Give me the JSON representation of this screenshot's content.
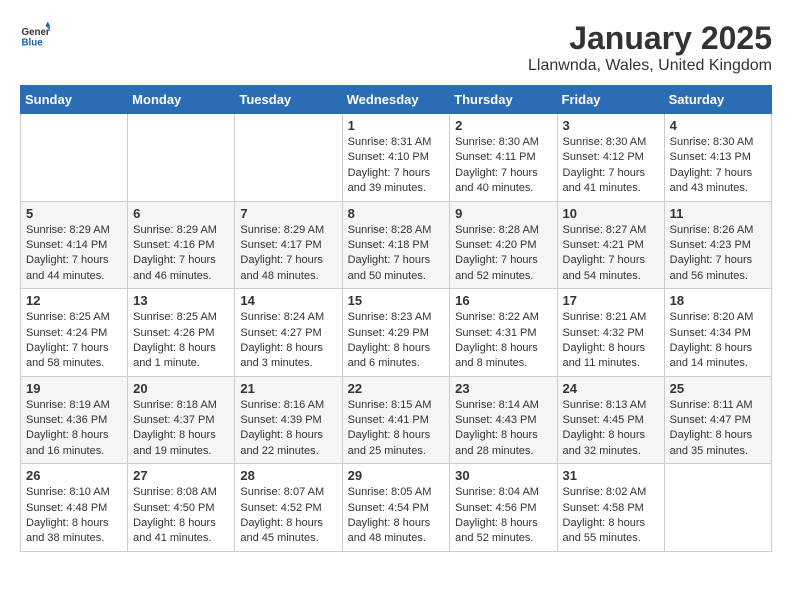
{
  "header": {
    "logo": {
      "general": "General",
      "blue": "Blue"
    },
    "title": "January 2025",
    "location": "Llanwnda, Wales, United Kingdom"
  },
  "weekdays": [
    "Sunday",
    "Monday",
    "Tuesday",
    "Wednesday",
    "Thursday",
    "Friday",
    "Saturday"
  ],
  "weeks": [
    [
      {
        "day": "",
        "content": ""
      },
      {
        "day": "",
        "content": ""
      },
      {
        "day": "",
        "content": ""
      },
      {
        "day": "1",
        "sunrise": "Sunrise: 8:31 AM",
        "sunset": "Sunset: 4:10 PM",
        "daylight": "Daylight: 7 hours and 39 minutes."
      },
      {
        "day": "2",
        "sunrise": "Sunrise: 8:30 AM",
        "sunset": "Sunset: 4:11 PM",
        "daylight": "Daylight: 7 hours and 40 minutes."
      },
      {
        "day": "3",
        "sunrise": "Sunrise: 8:30 AM",
        "sunset": "Sunset: 4:12 PM",
        "daylight": "Daylight: 7 hours and 41 minutes."
      },
      {
        "day": "4",
        "sunrise": "Sunrise: 8:30 AM",
        "sunset": "Sunset: 4:13 PM",
        "daylight": "Daylight: 7 hours and 43 minutes."
      }
    ],
    [
      {
        "day": "5",
        "sunrise": "Sunrise: 8:29 AM",
        "sunset": "Sunset: 4:14 PM",
        "daylight": "Daylight: 7 hours and 44 minutes."
      },
      {
        "day": "6",
        "sunrise": "Sunrise: 8:29 AM",
        "sunset": "Sunset: 4:16 PM",
        "daylight": "Daylight: 7 hours and 46 minutes."
      },
      {
        "day": "7",
        "sunrise": "Sunrise: 8:29 AM",
        "sunset": "Sunset: 4:17 PM",
        "daylight": "Daylight: 7 hours and 48 minutes."
      },
      {
        "day": "8",
        "sunrise": "Sunrise: 8:28 AM",
        "sunset": "Sunset: 4:18 PM",
        "daylight": "Daylight: 7 hours and 50 minutes."
      },
      {
        "day": "9",
        "sunrise": "Sunrise: 8:28 AM",
        "sunset": "Sunset: 4:20 PM",
        "daylight": "Daylight: 7 hours and 52 minutes."
      },
      {
        "day": "10",
        "sunrise": "Sunrise: 8:27 AM",
        "sunset": "Sunset: 4:21 PM",
        "daylight": "Daylight: 7 hours and 54 minutes."
      },
      {
        "day": "11",
        "sunrise": "Sunrise: 8:26 AM",
        "sunset": "Sunset: 4:23 PM",
        "daylight": "Daylight: 7 hours and 56 minutes."
      }
    ],
    [
      {
        "day": "12",
        "sunrise": "Sunrise: 8:25 AM",
        "sunset": "Sunset: 4:24 PM",
        "daylight": "Daylight: 7 hours and 58 minutes."
      },
      {
        "day": "13",
        "sunrise": "Sunrise: 8:25 AM",
        "sunset": "Sunset: 4:26 PM",
        "daylight": "Daylight: 8 hours and 1 minute."
      },
      {
        "day": "14",
        "sunrise": "Sunrise: 8:24 AM",
        "sunset": "Sunset: 4:27 PM",
        "daylight": "Daylight: 8 hours and 3 minutes."
      },
      {
        "day": "15",
        "sunrise": "Sunrise: 8:23 AM",
        "sunset": "Sunset: 4:29 PM",
        "daylight": "Daylight: 8 hours and 6 minutes."
      },
      {
        "day": "16",
        "sunrise": "Sunrise: 8:22 AM",
        "sunset": "Sunset: 4:31 PM",
        "daylight": "Daylight: 8 hours and 8 minutes."
      },
      {
        "day": "17",
        "sunrise": "Sunrise: 8:21 AM",
        "sunset": "Sunset: 4:32 PM",
        "daylight": "Daylight: 8 hours and 11 minutes."
      },
      {
        "day": "18",
        "sunrise": "Sunrise: 8:20 AM",
        "sunset": "Sunset: 4:34 PM",
        "daylight": "Daylight: 8 hours and 14 minutes."
      }
    ],
    [
      {
        "day": "19",
        "sunrise": "Sunrise: 8:19 AM",
        "sunset": "Sunset: 4:36 PM",
        "daylight": "Daylight: 8 hours and 16 minutes."
      },
      {
        "day": "20",
        "sunrise": "Sunrise: 8:18 AM",
        "sunset": "Sunset: 4:37 PM",
        "daylight": "Daylight: 8 hours and 19 minutes."
      },
      {
        "day": "21",
        "sunrise": "Sunrise: 8:16 AM",
        "sunset": "Sunset: 4:39 PM",
        "daylight": "Daylight: 8 hours and 22 minutes."
      },
      {
        "day": "22",
        "sunrise": "Sunrise: 8:15 AM",
        "sunset": "Sunset: 4:41 PM",
        "daylight": "Daylight: 8 hours and 25 minutes."
      },
      {
        "day": "23",
        "sunrise": "Sunrise: 8:14 AM",
        "sunset": "Sunset: 4:43 PM",
        "daylight": "Daylight: 8 hours and 28 minutes."
      },
      {
        "day": "24",
        "sunrise": "Sunrise: 8:13 AM",
        "sunset": "Sunset: 4:45 PM",
        "daylight": "Daylight: 8 hours and 32 minutes."
      },
      {
        "day": "25",
        "sunrise": "Sunrise: 8:11 AM",
        "sunset": "Sunset: 4:47 PM",
        "daylight": "Daylight: 8 hours and 35 minutes."
      }
    ],
    [
      {
        "day": "26",
        "sunrise": "Sunrise: 8:10 AM",
        "sunset": "Sunset: 4:48 PM",
        "daylight": "Daylight: 8 hours and 38 minutes."
      },
      {
        "day": "27",
        "sunrise": "Sunrise: 8:08 AM",
        "sunset": "Sunset: 4:50 PM",
        "daylight": "Daylight: 8 hours and 41 minutes."
      },
      {
        "day": "28",
        "sunrise": "Sunrise: 8:07 AM",
        "sunset": "Sunset: 4:52 PM",
        "daylight": "Daylight: 8 hours and 45 minutes."
      },
      {
        "day": "29",
        "sunrise": "Sunrise: 8:05 AM",
        "sunset": "Sunset: 4:54 PM",
        "daylight": "Daylight: 8 hours and 48 minutes."
      },
      {
        "day": "30",
        "sunrise": "Sunrise: 8:04 AM",
        "sunset": "Sunset: 4:56 PM",
        "daylight": "Daylight: 8 hours and 52 minutes."
      },
      {
        "day": "31",
        "sunrise": "Sunrise: 8:02 AM",
        "sunset": "Sunset: 4:58 PM",
        "daylight": "Daylight: 8 hours and 55 minutes."
      },
      {
        "day": "",
        "content": ""
      }
    ]
  ]
}
